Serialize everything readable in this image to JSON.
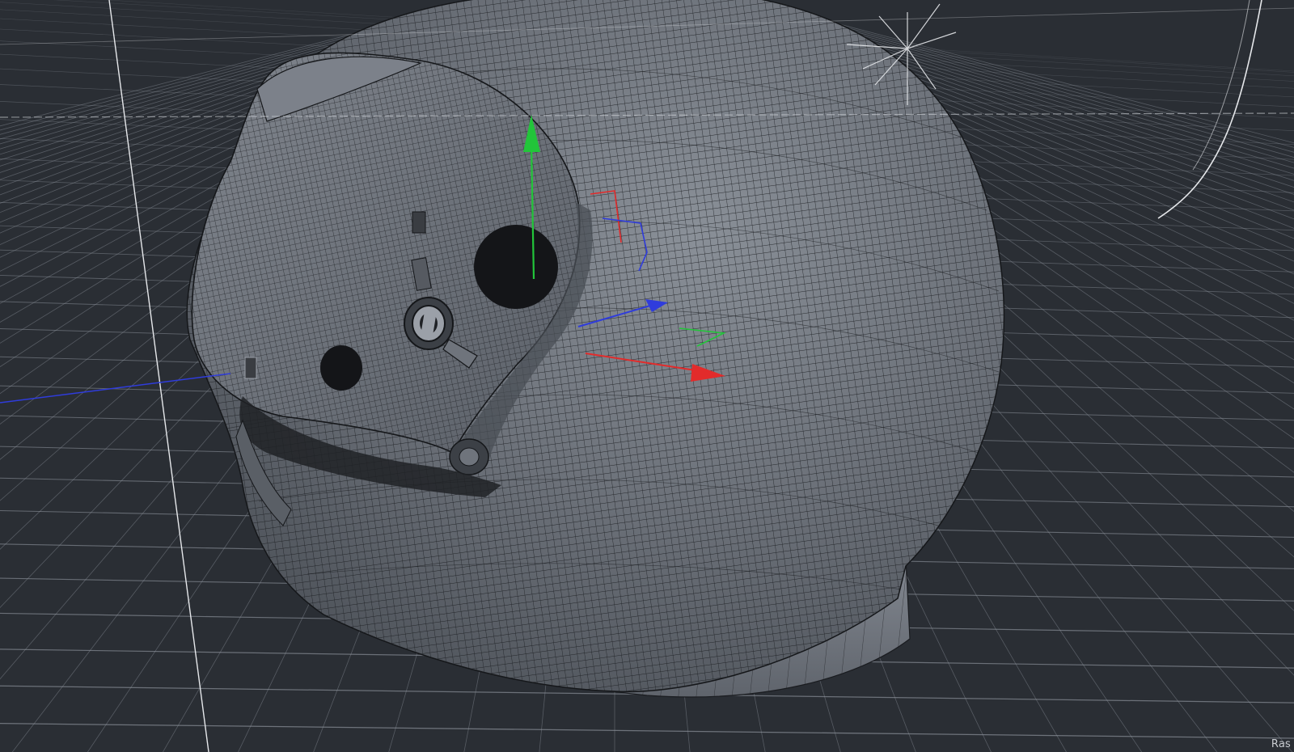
{
  "viewport": {
    "background_color": "#2a2e34",
    "grid_color": "#8d939c",
    "model_name": "helmet",
    "render_mode": "wireframe-on-shaded",
    "corner_label": "Ras"
  },
  "colors": {
    "helmet_shell": "#6b7078",
    "helmet_rim": "#7b8089",
    "wire": "#1a1c20",
    "visor_hole": "#141518",
    "axis_x": "#e22b2b",
    "axis_y": "#22c53a",
    "axis_z": "#2f3cdc",
    "light_helper": "#e6e8eb"
  },
  "icons": [
    "move-gizmo-icon",
    "local-axes-icon",
    "light-helper-icon",
    "camera-helper-icon"
  ]
}
